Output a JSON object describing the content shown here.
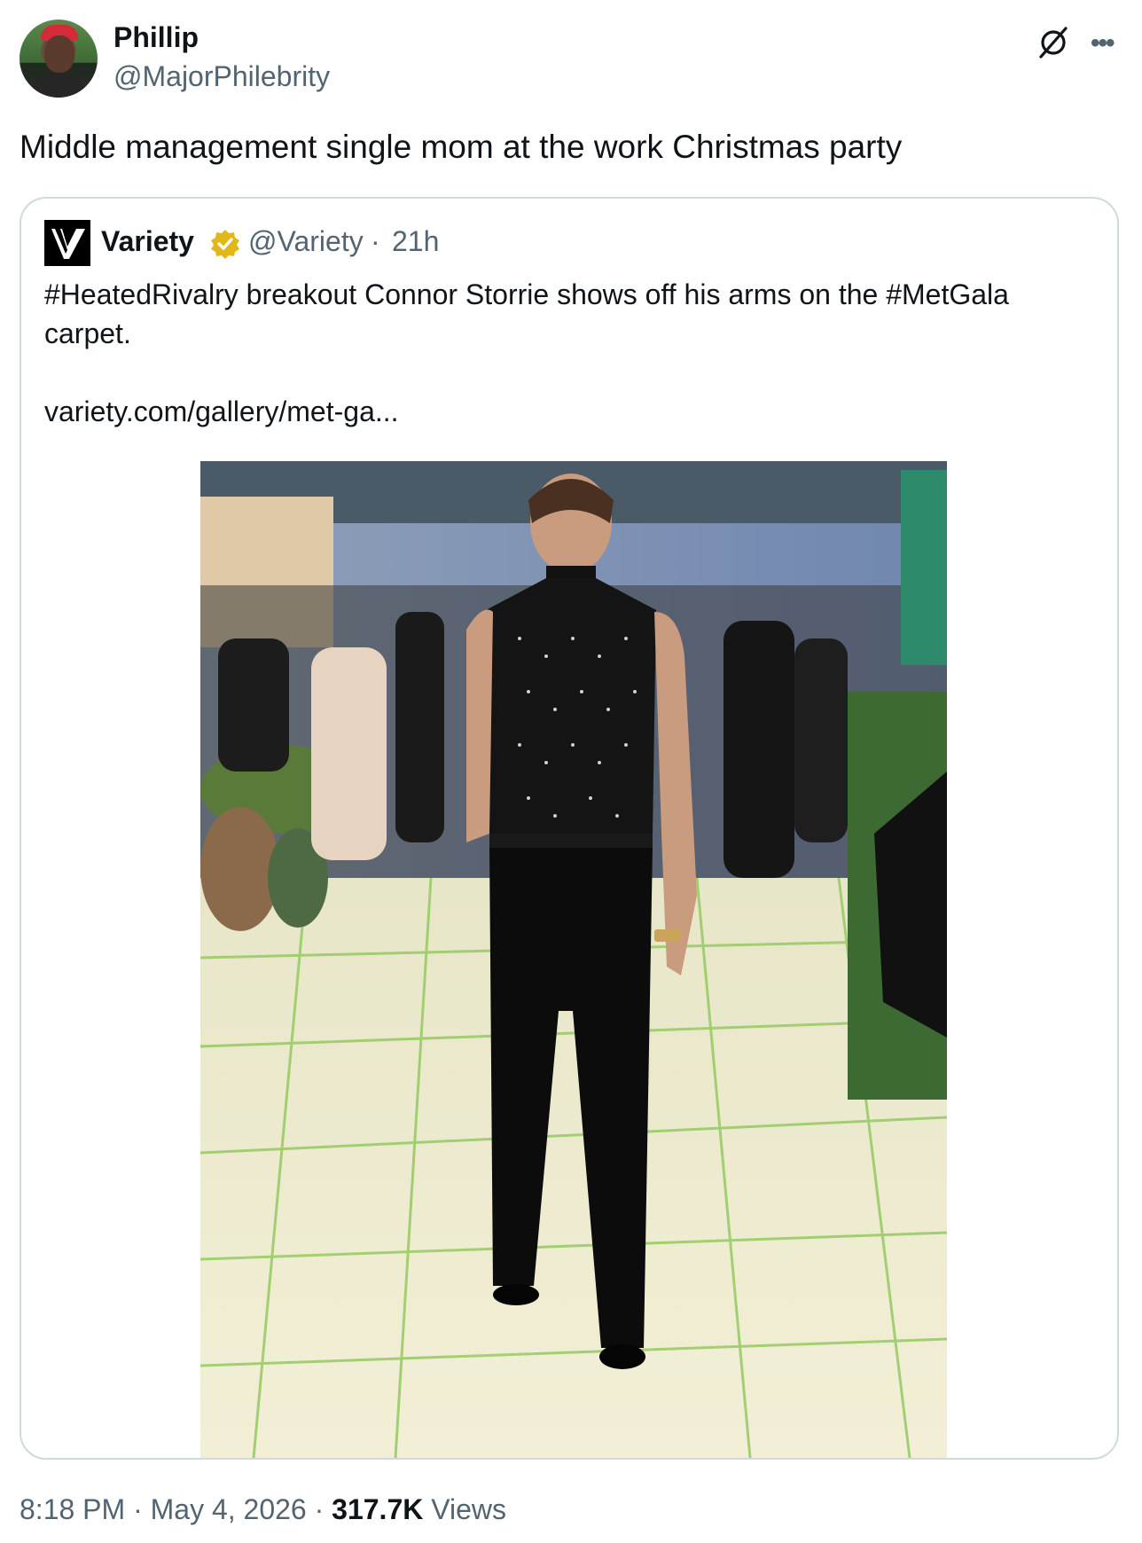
{
  "author": {
    "name": "Phillip",
    "handle": "@MajorPhilebrity",
    "avatar_icon": "profile-photo"
  },
  "tweet": {
    "text": "Middle management single mom at the work Christmas party"
  },
  "quoted": {
    "logo_icon": "variety-v-logo",
    "name": "Variety",
    "verified_icon": "gold-verified-badge",
    "handle": "@Variety",
    "separator": "·",
    "time": "21h",
    "text": "#HeatedRivalry breakout Connor Storrie shows off his arms on the #MetGala carpet.",
    "link": "variety.com/gallery/met-ga...",
    "media_description_icon": "photo"
  },
  "footer": {
    "time": "8:18 PM",
    "sep1": "·",
    "date": "May 4, 2026",
    "sep2": "·",
    "views_count": "317.7K",
    "views_label": "Views"
  },
  "icons": {
    "grok": "grok-icon",
    "more": "more-options-icon"
  },
  "colors": {
    "text_primary": "#0f1419",
    "text_secondary": "#536471",
    "border": "#cfd9de",
    "verified_gold": "#e2b719"
  }
}
